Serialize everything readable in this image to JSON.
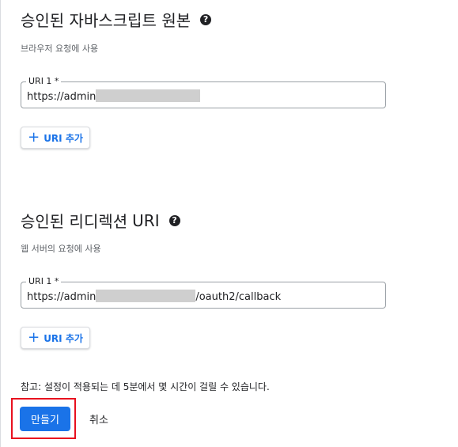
{
  "js_origins": {
    "title": "승인된 자바스크립트 원본",
    "subtitle": "브라우저 요청에 사용",
    "field_label": "URI 1 *",
    "field_value": "https://admin",
    "add_label": "URI 추가"
  },
  "redirect_uris": {
    "title_ko": "승인된 리디렉션 ",
    "title_uri": "URI",
    "subtitle": "웹 서버의 요청에 사용",
    "field_label": "URI 1 *",
    "field_value_prefix": "https://admin",
    "field_value_suffix": "/oauth2/callback",
    "add_label": "URI 추가"
  },
  "note": "참고: 설정이 적용되는 데 5분에서 몇 시간이 걸릴 수 있습니다.",
  "actions": {
    "create_label": "만들기",
    "cancel_label": "취소"
  },
  "icons": {
    "help": "help-icon",
    "add": "plus-icon"
  }
}
